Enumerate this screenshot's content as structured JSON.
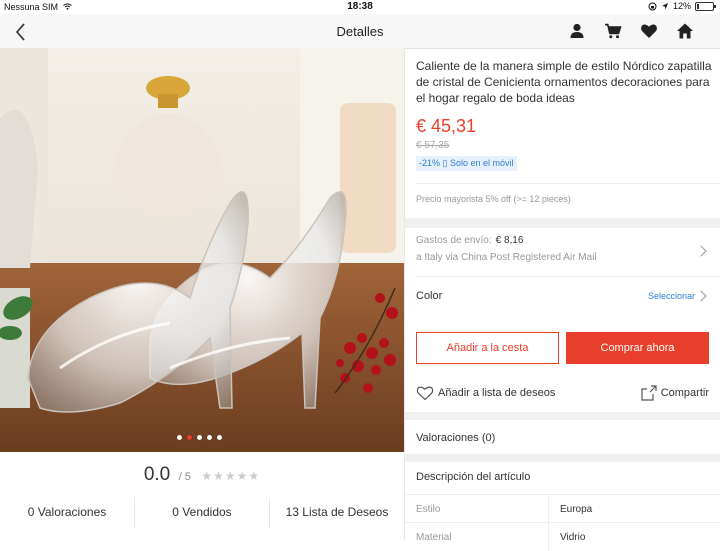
{
  "status_bar": {
    "carrier": "Nessuna SIM",
    "time": "18:38",
    "battery": "12%"
  },
  "navbar": {
    "title": "Detalles",
    "icons": [
      "user-icon",
      "cart-icon",
      "heart-icon",
      "home-icon"
    ]
  },
  "gallery": {
    "image_count": 5,
    "active_index": 1
  },
  "rating": {
    "score": "0.0",
    "out_of": "/ 5",
    "stars": 0
  },
  "stats": {
    "reviews": "0 Valoraciones",
    "sold": "0 Vendidos",
    "wishlist": "13 Lista de Deseos"
  },
  "product": {
    "title": "Caliente de la manera simple de estilo Nórdico zapatilla de cristal de Cenicienta ornamentos decoraciones para el hogar regalo de boda ideas",
    "price": "€ 45,31",
    "old_price": "€ 57,35",
    "mobile_discount": "-21% ▯ Solo en el móvil",
    "wholesale": "Precio mayorista 5% off (>= 12 pieces)"
  },
  "shipping": {
    "label": "Gastos de envío:",
    "cost": "€ 8,16",
    "route": "a Italy via China Post Registered Air Mail"
  },
  "color": {
    "label": "Color",
    "select": "Seleccionar"
  },
  "actions": {
    "add_to_cart": "Añadir a la cesta",
    "buy_now": "Comprar ahora",
    "wishlist": "Añadir a lista de deseos",
    "share": "Compartir"
  },
  "reviews_section": "Valoraciones (0)",
  "description": {
    "title": "Descripción del artículo",
    "specs": [
      {
        "key": "Estilo",
        "value": "Europa"
      },
      {
        "key": "Material",
        "value": "Vidrio"
      }
    ]
  },
  "colors": {
    "accent": "#e8402b",
    "link": "#2e7dd1"
  }
}
